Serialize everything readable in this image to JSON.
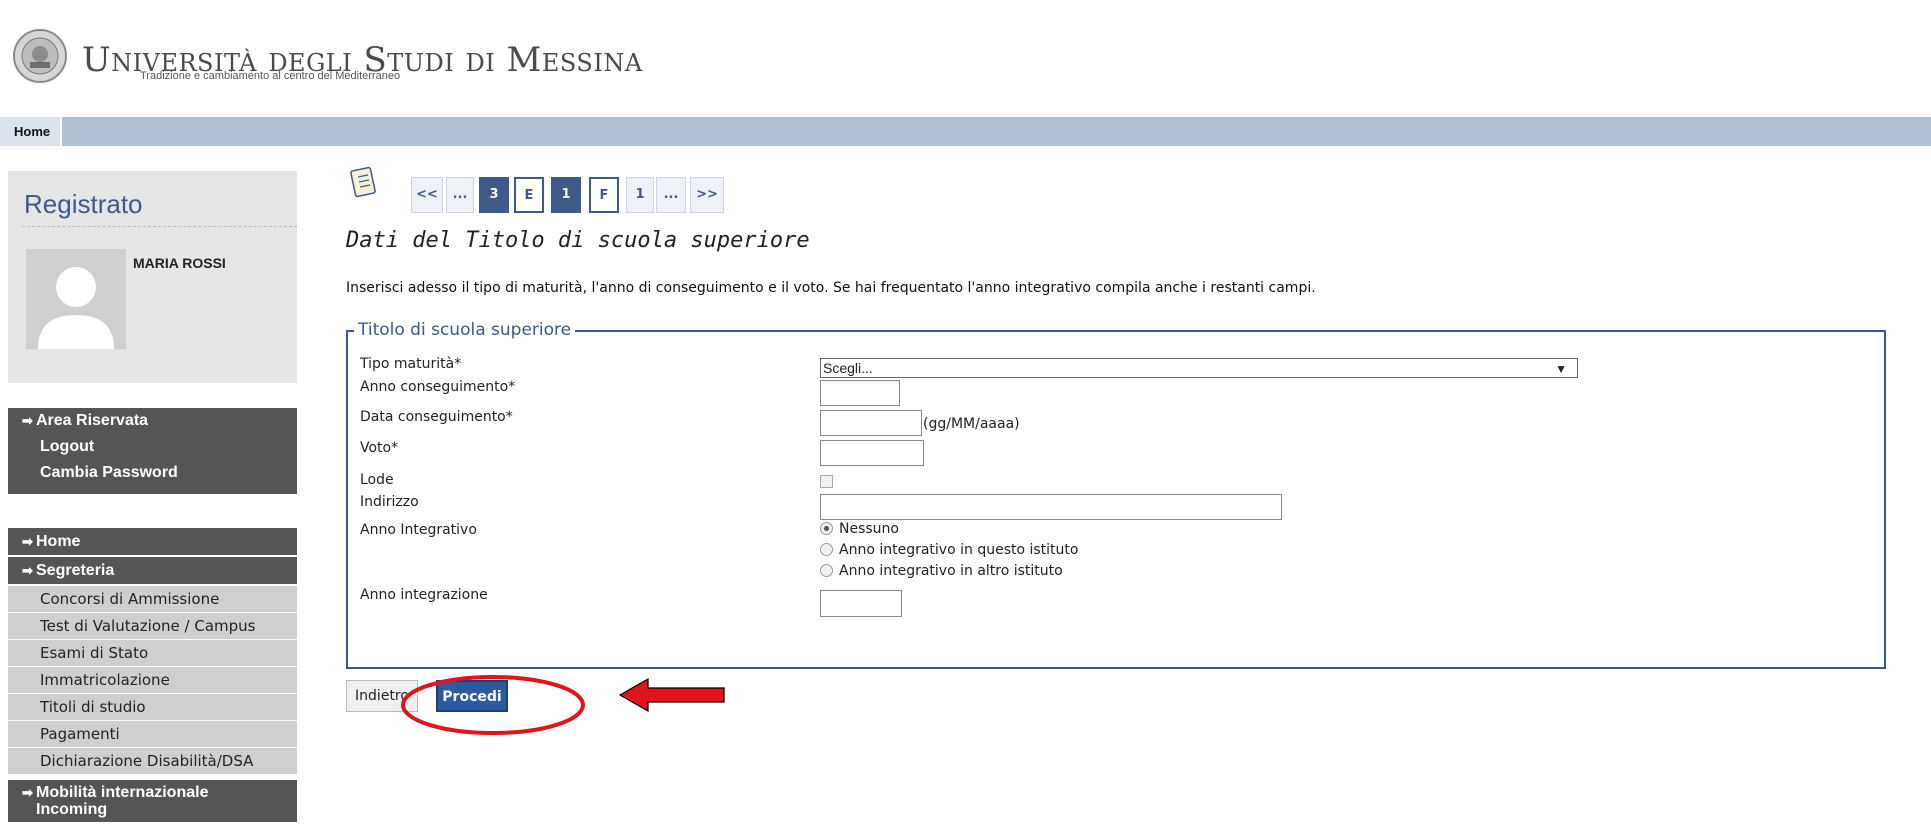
{
  "header": {
    "university_name": "Università degli Studi di Messina",
    "tagline": "Tradizione e cambiamento al centro del Mediterraneo",
    "logo_icon": "university-seal-icon"
  },
  "topbar": {
    "home_label": "Home"
  },
  "user_panel": {
    "title": "Registrato",
    "user_name": "MARIA ROSSI",
    "avatar_icon": "user-avatar-icon"
  },
  "area_menu": {
    "head": "Area Riservata",
    "items": [
      "Logout",
      "Cambia Password"
    ]
  },
  "main_menu": {
    "home": "Home",
    "segreteria": "Segreteria",
    "items": [
      "Concorsi di Ammissione",
      "Test di Valutazione / Campus",
      "Esami di Stato",
      "Immatricolazione",
      "Titoli di studio",
      "Pagamenti",
      "Dichiarazione Disabilità/DSA"
    ],
    "mobility_line1": "Mobilità internazionale",
    "mobility_line2": "Incoming"
  },
  "pager": {
    "items": [
      "<<",
      "...",
      "3",
      "E",
      "1",
      "F",
      "1",
      "...",
      ">>"
    ],
    "current": "1"
  },
  "page": {
    "title": "Dati del Titolo di scuola superiore",
    "intro": "Inserisci adesso il tipo di maturità, l'anno di conseguimento e il voto. Se hai frequentato l'anno integrativo compila anche i restanti campi."
  },
  "form": {
    "legend": "Titolo di scuola superiore",
    "tipo_label": "Tipo maturità*",
    "tipo_value": "Scegli...",
    "anno_label": "Anno conseguimento*",
    "data_label": "Data conseguimento*",
    "data_hint": "(gg/MM/aaaa)",
    "voto_label": "Voto*",
    "lode_label": "Lode",
    "indirizzo_label": "Indirizzo",
    "integrativo_label": "Anno Integrativo",
    "radio_options": [
      "Nessuno",
      "Anno integrativo in questo istituto",
      "Anno integrativo in altro istituto"
    ],
    "radio_selected": 0,
    "integrazione_label": "Anno integrazione"
  },
  "buttons": {
    "back": "Indietro",
    "next": "Procedi"
  },
  "colors": {
    "accent": "#3d5a8a",
    "topbar": "#afc2d3",
    "menu_dark": "#555555",
    "annotation_red": "#e0141a"
  }
}
